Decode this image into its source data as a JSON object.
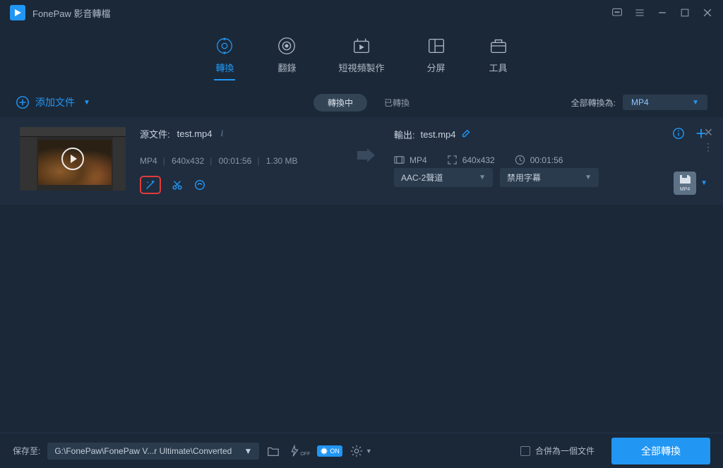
{
  "app": {
    "title": "FonePaw 影音轉檔"
  },
  "main_tabs": [
    {
      "label": "轉換",
      "active": true
    },
    {
      "label": "翻錄",
      "active": false
    },
    {
      "label": "短視頻製作",
      "active": false
    },
    {
      "label": "分屏",
      "active": false
    },
    {
      "label": "工具",
      "active": false
    }
  ],
  "sub_bar": {
    "add_file": "添加文件",
    "tab_converting": "轉換中",
    "tab_converted": "已轉換",
    "convert_all_to_label": "全部轉換為:",
    "convert_all_to_value": "MP4"
  },
  "file": {
    "source_label": "源文件:",
    "source_name": "test.mp4",
    "specs": {
      "format": "MP4",
      "resolution": "640x432",
      "duration": "00:01:56",
      "size": "1.30 MB"
    },
    "output_label": "輸出:",
    "output_name": "test.mp4",
    "out_specs": {
      "format": "MP4",
      "resolution": "640x432",
      "duration": "00:01:56"
    },
    "audio_select": "AAC-2聲道",
    "subtitle_select": "禁用字幕",
    "badge_format": "MP4"
  },
  "footer": {
    "save_to_label": "保存至:",
    "save_path": "G:\\FonePaw\\FonePaw V...r Ultimate\\Converted",
    "merge_label": "合併為一個文件",
    "convert_all": "全部轉換",
    "hw_on": "ON"
  }
}
